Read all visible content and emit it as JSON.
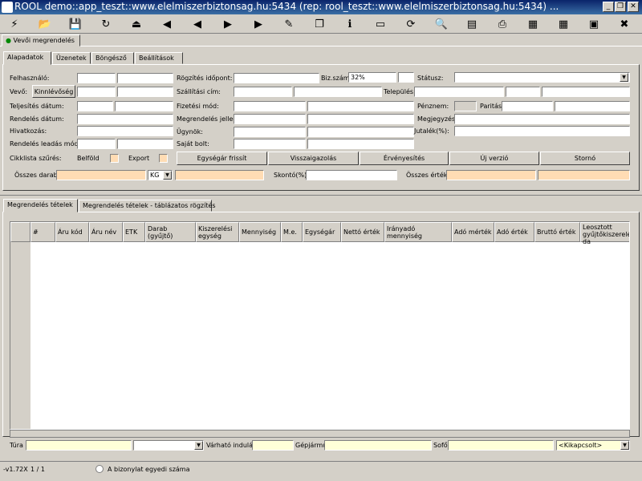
{
  "window": {
    "title": "ROOL demo::app_teszt::www.elelmiszerbiztonsag.hu:5434 (rep: rool_teszt::www.elelmiszerbiztonsag.hu:5434) ...",
    "minimize": "_",
    "restore": "❐",
    "close": "✕"
  },
  "toolbar": {
    "icons": [
      "lightning-icon",
      "open-folder-icon",
      "save-icon",
      "refresh-arrow-icon",
      "home-icon",
      "first-icon",
      "prev-icon",
      "next-icon",
      "last-icon",
      "edit-icon",
      "copy-icon",
      "info-icon",
      "form-icon",
      "reload-icon",
      "search-icon",
      "list-icon",
      "print-icon",
      "table-icon",
      "table-edit-icon",
      "window-icon",
      "close-red-icon"
    ],
    "glyphs": [
      "⚡",
      "📂",
      "💾",
      "↻",
      "⏏",
      "◀",
      "◀",
      "▶",
      "▶",
      "✎",
      "❐",
      "ℹ",
      "▭",
      "⟳",
      "🔍",
      "▤",
      "⎙",
      "▦",
      "▦",
      "▣",
      "✖"
    ]
  },
  "page_tab": "Vevői megrendelés",
  "tabs": [
    "Alapadatok",
    "Üzenetek",
    "Böngésző",
    "Beállítások"
  ],
  "form": {
    "felhasznalo": "Felhasználó:",
    "vevo": "Vevő:",
    "kinnlevoseg": "Kinnlévőség",
    "teljesites": "Teljesítés dátum:",
    "rendeles_datum": "Rendelés dátum:",
    "hivatkozas": "Hivatkozás:",
    "leadas_mod": "Rendelés leadás mód:",
    "rogzites": "Rögzítés időpont:",
    "biz_szam": "Biz.szám:",
    "biz_szam_value": "32%",
    "szallitasi": "Szállítási cím:",
    "fizetesi": "Fizetési mód:",
    "jelleg": "Megrendelés jelleg:",
    "ugynok": "Ügynök:",
    "sajat_bolt": "Saját bolt:",
    "statusz": "Státusz:",
    "telepules": "Település:",
    "penznem": "Pénznem:",
    "paritas": "Paritás:",
    "megjegyzes": "Megjegyzés:",
    "jutalek": "Jutalék(%):",
    "cikklista": "Cikklista szűrés:",
    "belfold": "Belföld",
    "export": "Export",
    "osszes_darab": "Összes darab:",
    "kg": "KG",
    "skonto": "Skontó(%):",
    "osszes_ertek": "Összes érték:"
  },
  "buttons": [
    "Egységár frissít",
    "Visszaigazolás",
    "Érvényesítés",
    "Új verzió",
    "Stornó"
  ],
  "lower_tabs": [
    "Megrendelés tételek",
    "Megrendelés tételek - táblázatos rögzítés"
  ],
  "columns": [
    "#",
    "Áru kód",
    "Áru név",
    "ETK",
    "Darab (gyűjtő)",
    "Kiszerelési egység",
    "Mennyiség",
    "M.e.",
    "Egységár",
    "Nettó érték",
    "Irányadó mennyiség",
    "Adó mérték",
    "Adó érték",
    "Bruttó érték",
    "Leosztott gyűjtőkiszerelés da"
  ],
  "bottom": {
    "tura": "Túra",
    "varhato": "Várható indulás",
    "gepjarmu": "Gépjármű",
    "sofor": "Sofőr",
    "kikapcsolt": "<Kikapcsolt>"
  },
  "status": {
    "version": "-v1.72X",
    "page": "1 / 1",
    "radio_label": "A bizonylat egyedi száma"
  }
}
